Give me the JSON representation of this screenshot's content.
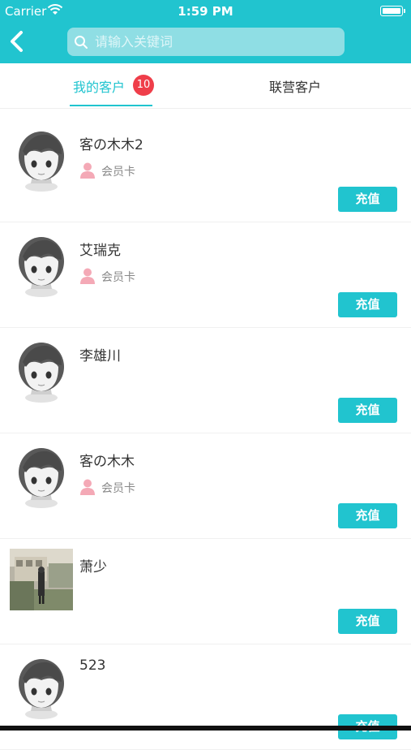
{
  "status_bar": {
    "carrier": "Carrier",
    "time": "1:59 PM"
  },
  "search": {
    "placeholder": "请输入关键词"
  },
  "tabs": [
    {
      "label": "我的客户",
      "badge": "10",
      "active": true
    },
    {
      "label": "联营客户",
      "active": false
    }
  ],
  "customers": [
    {
      "name": "客の木木2",
      "member_label": "会员卡",
      "action_label": "充值",
      "avatar": "cartoon"
    },
    {
      "name": "艾瑞克",
      "member_label": "会员卡",
      "action_label": "充值",
      "avatar": "cartoon"
    },
    {
      "name": "李雄川",
      "member_label": "",
      "action_label": "充值",
      "avatar": "cartoon"
    },
    {
      "name": "客の木木",
      "member_label": "会员卡",
      "action_label": "充值",
      "avatar": "cartoon"
    },
    {
      "name": "萧少",
      "member_label": "",
      "action_label": "充值",
      "avatar": "photo"
    },
    {
      "name": "523",
      "member_label": "",
      "action_label": "充值",
      "avatar": "cartoon"
    }
  ],
  "colors": {
    "accent": "#21c4cf",
    "badge": "#ef3e4a",
    "member_icon": "#f4a9b6"
  }
}
